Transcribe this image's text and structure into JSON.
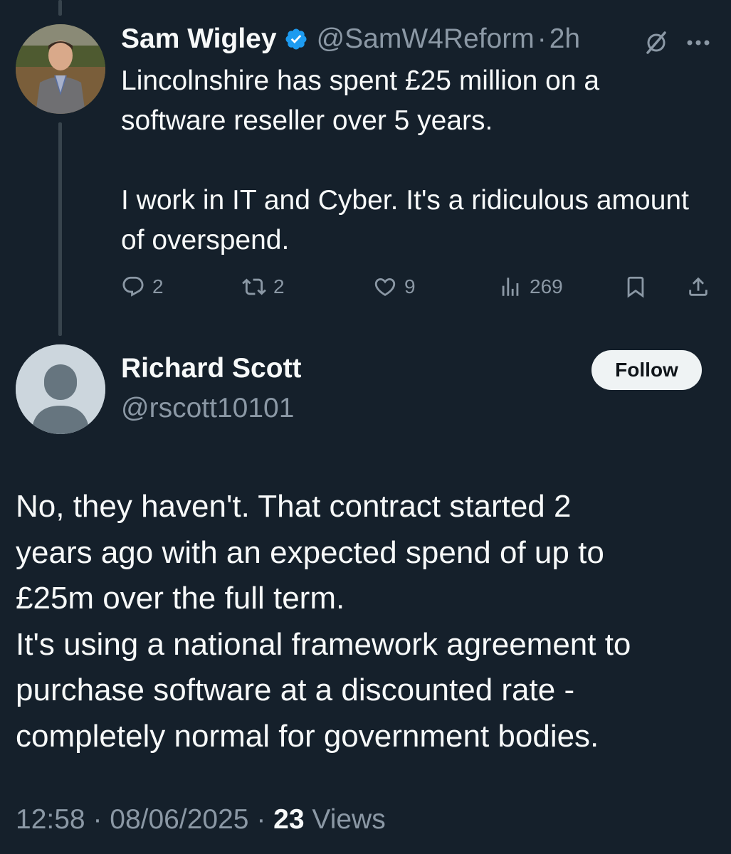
{
  "tweet": {
    "display_name": "Sam Wigley",
    "handle": "@SamW4Reform",
    "separator": "·",
    "time": "2h",
    "text_paragraphs": [
      "Lincolnshire has spent £25 million on a software reseller over 5 years.",
      "I work in IT and Cyber.  It's a ridiculous amount of overspend."
    ],
    "actions": {
      "replies": "2",
      "reposts": "2",
      "likes": "9",
      "views": "269"
    }
  },
  "reply": {
    "display_name": "Richard Scott",
    "handle": "@rscott10101",
    "follow_label": "Follow",
    "text_lines": [
      "No, they haven't. That contract started 2",
      "years ago with an expected spend of up to",
      "£25m over the full term.",
      "It's using a national framework agreement to",
      "purchase software at a discounted rate -",
      "completely normal for government bodies."
    ],
    "meta": {
      "time": "12:58",
      "separator": " · ",
      "date": "08/06/2025",
      "views_count": "23",
      "views_label": "Views"
    }
  },
  "colors": {
    "background": "#15202b",
    "primary_text": "#f7f9f9",
    "secondary_text": "#8b98a5",
    "verified_badge": "#1d9bf0",
    "thread_line": "#38444d"
  },
  "icons": {
    "verified": "verified-badge-icon",
    "grok": "grok-icon",
    "more": "more-icon",
    "reply": "reply-icon",
    "repost": "repost-icon",
    "like": "heart-icon",
    "views": "views-icon",
    "bookmark": "bookmark-icon",
    "share": "share-icon"
  }
}
